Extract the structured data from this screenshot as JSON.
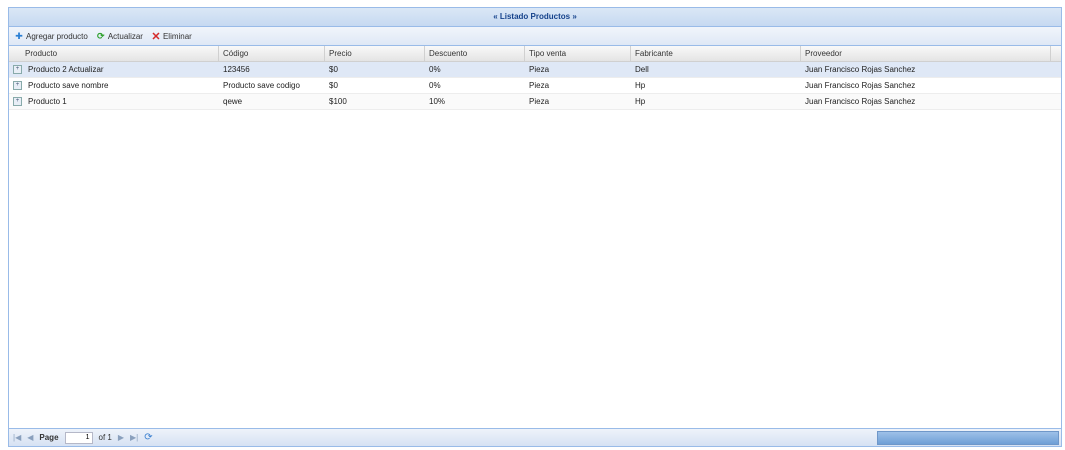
{
  "title": "Listado Productos",
  "toolbar": {
    "add_label": "Agregar producto",
    "add_icon": "add-icon",
    "refresh_label": "Actualizar",
    "refresh_icon": "refresh-icon",
    "delete_label": "Eliminar",
    "delete_icon": "delete-icon"
  },
  "columns": [
    "Producto",
    "Código",
    "Precio",
    "Descuento",
    "Tipo venta",
    "Fabricante",
    "Proveedor"
  ],
  "rows": [
    [
      "Producto 2 Actualizar",
      "123456",
      "$0",
      "0%",
      "Pieza",
      "Dell",
      "Juan Francisco Rojas Sanchez"
    ],
    [
      "Producto save nombre",
      "Producto save codigo",
      "$0",
      "0%",
      "Pieza",
      "Hp",
      "Juan Francisco Rojas Sanchez"
    ],
    [
      "Producto 1",
      "qewe",
      "$100",
      "10%",
      "Pieza",
      "Hp",
      "Juan Francisco Rojas Sanchez"
    ]
  ],
  "pager": {
    "page_label": "Page",
    "page_value": "1",
    "of_label": "of 1"
  },
  "colors": {
    "header_blue": "#15428b",
    "selected_row": "#dfe8f6",
    "border": "#99bbe8"
  }
}
